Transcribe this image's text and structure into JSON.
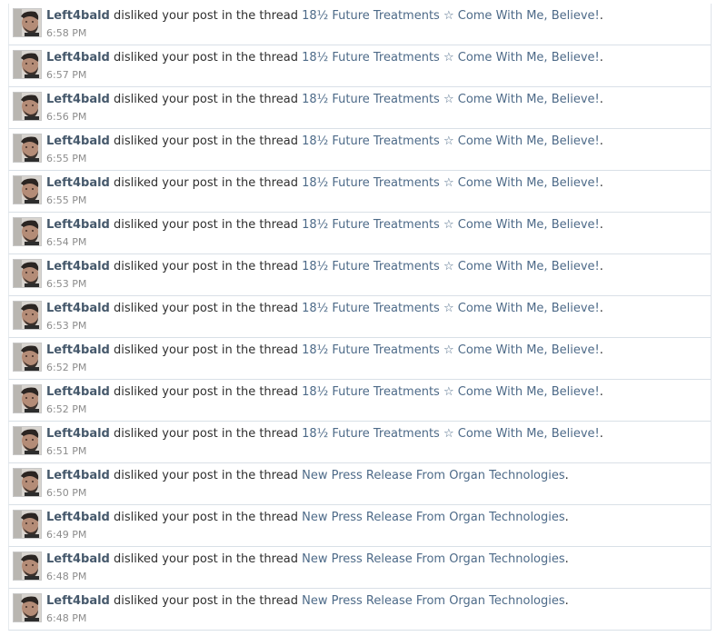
{
  "alerts": [
    {
      "user": "Left4bald",
      "action": "disliked your post in the thread",
      "thread": "18½ Future Treatments ☆ Come With Me, Believe!",
      "period": ".",
      "time": "6:58 PM"
    },
    {
      "user": "Left4bald",
      "action": "disliked your post in the thread",
      "thread": "18½ Future Treatments ☆ Come With Me, Believe!",
      "period": ".",
      "time": "6:57 PM"
    },
    {
      "user": "Left4bald",
      "action": "disliked your post in the thread",
      "thread": "18½ Future Treatments ☆ Come With Me, Believe!",
      "period": ".",
      "time": "6:56 PM"
    },
    {
      "user": "Left4bald",
      "action": "disliked your post in the thread",
      "thread": "18½ Future Treatments ☆ Come With Me, Believe!",
      "period": ".",
      "time": "6:55 PM"
    },
    {
      "user": "Left4bald",
      "action": "disliked your post in the thread",
      "thread": "18½ Future Treatments ☆ Come With Me, Believe!",
      "period": ".",
      "time": "6:55 PM"
    },
    {
      "user": "Left4bald",
      "action": "disliked your post in the thread",
      "thread": "18½ Future Treatments ☆ Come With Me, Believe!",
      "period": ".",
      "time": "6:54 PM"
    },
    {
      "user": "Left4bald",
      "action": "disliked your post in the thread",
      "thread": "18½ Future Treatments ☆ Come With Me, Believe!",
      "period": ".",
      "time": "6:53 PM"
    },
    {
      "user": "Left4bald",
      "action": "disliked your post in the thread",
      "thread": "18½ Future Treatments ☆ Come With Me, Believe!",
      "period": ".",
      "time": "6:53 PM"
    },
    {
      "user": "Left4bald",
      "action": "disliked your post in the thread",
      "thread": "18½ Future Treatments ☆ Come With Me, Believe!",
      "period": ".",
      "time": "6:52 PM"
    },
    {
      "user": "Left4bald",
      "action": "disliked your post in the thread",
      "thread": "18½ Future Treatments ☆ Come With Me, Believe!",
      "period": ".",
      "time": "6:52 PM"
    },
    {
      "user": "Left4bald",
      "action": "disliked your post in the thread",
      "thread": "18½ Future Treatments ☆ Come With Me, Believe!",
      "period": ".",
      "time": "6:51 PM"
    },
    {
      "user": "Left4bald",
      "action": "disliked your post in the thread",
      "thread": "New Press Release From Organ Technologies",
      "period": ".",
      "time": "6:50 PM"
    },
    {
      "user": "Left4bald",
      "action": "disliked your post in the thread",
      "thread": "New Press Release From Organ Technologies",
      "period": ".",
      "time": "6:49 PM"
    },
    {
      "user": "Left4bald",
      "action": "disliked your post in the thread",
      "thread": "New Press Release From Organ Technologies",
      "period": ".",
      "time": "6:48 PM"
    },
    {
      "user": "Left4bald",
      "action": "disliked your post in the thread",
      "thread": "New Press Release From Organ Technologies",
      "period": ".",
      "time": "6:48 PM"
    }
  ],
  "colors": {
    "username": "#45586b",
    "link": "#4d6a88",
    "time": "#8c8c8c",
    "divider": "#d9e0e7"
  },
  "icons": {
    "avatar": "user-avatar-photo"
  }
}
